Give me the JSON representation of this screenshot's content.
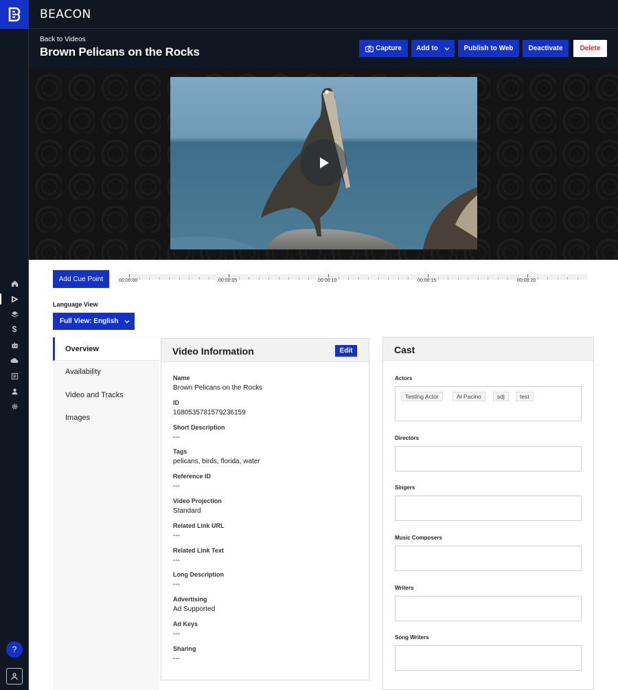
{
  "brand": {
    "name": "BEACON",
    "logo_letter": "B"
  },
  "header": {
    "back_link": "Back to Videos",
    "title": "Brown Pelicans on the Rocks",
    "actions": {
      "capture": "Capture",
      "add_to": "Add to",
      "publish": "Publish to Web",
      "deactivate": "Deactivate",
      "delete": "Delete"
    }
  },
  "sidebar_icons": [
    "home-icon",
    "videos-icon",
    "layers-icon",
    "dollar-icon",
    "robot-icon",
    "cloud-icon",
    "document-icon",
    "user-icon",
    "settings-icon"
  ],
  "help": {
    "label": "?"
  },
  "cue": {
    "button": "Add Cue Point",
    "ticks": [
      "00:00:00",
      "00:00:05",
      "00:00:10",
      "00:00:15",
      "00:00:20"
    ]
  },
  "language": {
    "label": "Language View",
    "selected": "Full View: English"
  },
  "tabs": [
    "Overview",
    "Availability",
    "Video and Tracks",
    "Images"
  ],
  "info": {
    "title": "Video Information",
    "edit": "Edit",
    "fields": [
      {
        "label": "Name",
        "value": "Brown Pelicans on the Rocks"
      },
      {
        "label": "ID",
        "value": "1680535781579236159"
      },
      {
        "label": "Short Description",
        "value": "---"
      },
      {
        "label": "Tags",
        "value": "pelicans, birds, florida, water"
      },
      {
        "label": "Reference ID",
        "value": "---"
      },
      {
        "label": "Video Projection",
        "value": "Standard"
      },
      {
        "label": "Related Link URL",
        "value": "---"
      },
      {
        "label": "Related Link Text",
        "value": "---"
      },
      {
        "label": "Long Description",
        "value": "---"
      },
      {
        "label": "Advertising",
        "value": "Ad Supported"
      },
      {
        "label": "Ad Keys",
        "value": "---"
      },
      {
        "label": "Sharing",
        "value": "---"
      }
    ]
  },
  "cast": {
    "title": "Cast",
    "sections": [
      {
        "label": "Actors",
        "chips": [
          "Testing Actor",
          "Al Pacino",
          "sdj",
          "test"
        ]
      },
      {
        "label": "Directors",
        "chips": []
      },
      {
        "label": "Singers",
        "chips": []
      },
      {
        "label": "Music Composers",
        "chips": []
      },
      {
        "label": "Writers",
        "chips": []
      },
      {
        "label": "Song Writers",
        "chips": []
      }
    ]
  },
  "colors": {
    "accent": "#1431c8",
    "dark": "#0f1722",
    "danger": "#d9312b"
  }
}
